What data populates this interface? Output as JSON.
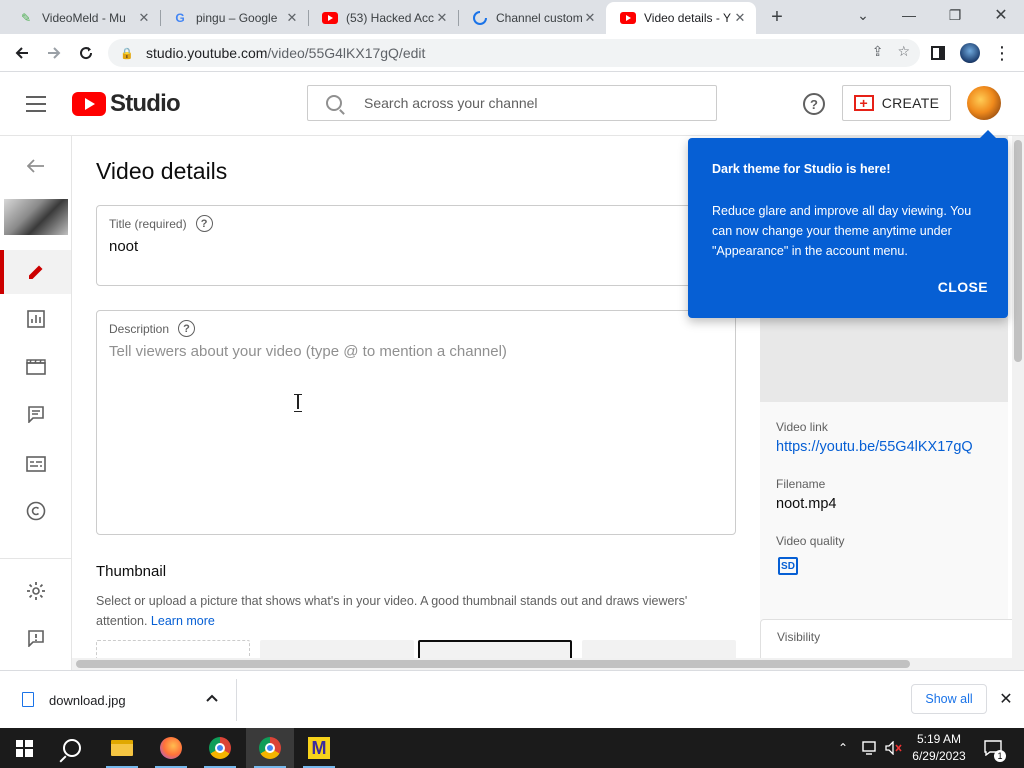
{
  "browser": {
    "tabs": [
      {
        "title": "VideoMeld - Mu",
        "favicon": "videomeld-icon",
        "active": false
      },
      {
        "title": "pingu – Google",
        "favicon": "google-icon",
        "active": false
      },
      {
        "title": "(53) Hacked Acc",
        "favicon": "youtube-icon",
        "active": false
      },
      {
        "title": "Channel custom",
        "favicon": "loading-icon",
        "active": false
      },
      {
        "title": "Video details - Y",
        "favicon": "youtube-icon",
        "active": true
      }
    ],
    "url_host": "studio.youtube.com",
    "url_path": "/video/55G4lKX17gQ/edit"
  },
  "header": {
    "logo_text": "Studio",
    "search_placeholder": "Search across your channel",
    "create_label": "CREATE"
  },
  "page": {
    "title": "Video details",
    "title_field": {
      "label": "Title (required)",
      "value": "noot"
    },
    "description_field": {
      "label": "Description",
      "placeholder": "Tell viewers about your video (type @ to mention a channel)"
    },
    "thumbnail": {
      "heading": "Thumbnail",
      "description": "Select or upload a picture that shows what's in your video. A good thumbnail stands out and draws viewers' attention.",
      "learn_more": "Learn more"
    }
  },
  "side_panel": {
    "video_link_label": "Video link",
    "video_link": "https://youtu.be/55G4lKX17gQ",
    "filename_label": "Filename",
    "filename": "noot.mp4",
    "quality_label": "Video quality",
    "quality_badge": "SD",
    "visibility_label": "Visibility"
  },
  "popup": {
    "title": "Dark theme for Studio is here!",
    "body": "Reduce glare and improve all day viewing. You can now change your theme anytime under \"Appearance\" in the account menu.",
    "close_label": "CLOSE"
  },
  "download_bar": {
    "filename": "download.jpg",
    "show_all": "Show all"
  },
  "taskbar": {
    "time": "5:19 AM",
    "date": "6/29/2023",
    "notification_count": "1"
  },
  "colors": {
    "accent_blue": "#065fd4",
    "youtube_red": "#ff0000",
    "active_nav_red": "#cc0000"
  }
}
